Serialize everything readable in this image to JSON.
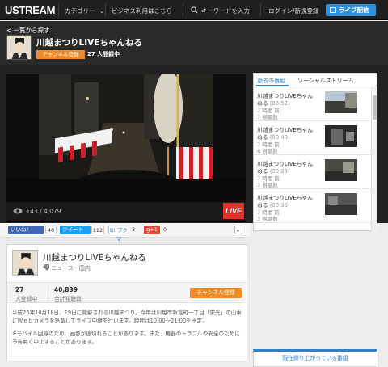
{
  "nav": {
    "logo": "USTREAM",
    "category": "カテゴリー",
    "chevron": "⌄",
    "business": "ビジネス利用はこちら",
    "search_placeholder": "キーワードを入力",
    "login": "ログイン/新規登録",
    "live_button": "ライブ配信"
  },
  "header": {
    "back_link": "< 一覧から探す",
    "channel_title": "川越まつりLIVEちゃんねる",
    "subscribe": "チャンネル登録",
    "subscribers": "27 人登録中"
  },
  "player": {
    "viewcount": "143 / 4,079",
    "live_badge": "LIVE"
  },
  "side": {
    "tabs": [
      "過去の番組",
      "ソーシャルストリーム"
    ],
    "items": [
      {
        "title": "川越まつりLIVEちゃん",
        "title2": "ねる",
        "duration": "(06:52)",
        "ago": "7 時間 前",
        "views": "7 視聴数"
      },
      {
        "title": "川越まつりLIVEちゃん",
        "title2": "ねる",
        "duration": "(00:40)",
        "ago": "7 時間 前",
        "views": "6 視聴数"
      },
      {
        "title": "川越まつりLIVEちゃん",
        "title2": "ねる",
        "duration": "(00:28)",
        "ago": "7 時間 前",
        "views": "3 視聴数"
      },
      {
        "title": "川越まつりLIVEちゃん",
        "title2": "ねる",
        "duration": "(00:30)",
        "ago": "7 時間 前",
        "views": "3 視聴数"
      }
    ],
    "related": "現在繰り上がっている番組"
  },
  "social": {
    "fb_label": "いいね！",
    "fb_count": "40",
    "tw_label": "ツイート",
    "tw_count": "112",
    "hatena_label": "B! ブクマ",
    "hatena_count": "3",
    "gplus_label": "g+1",
    "gplus_count": "0",
    "share": "▸"
  },
  "info": {
    "title": "川越まつりLIVEちゃんねる",
    "category": "ニュース - 国内",
    "stat1_num": "27",
    "stat1_lbl": "人登録中",
    "stat2_num": "40,839",
    "stat2_lbl": "合計視聴数",
    "subscribe": "チャンネル登録",
    "desc1": "平成26年10月18日、19日に開催される川越まつり。今年は川越市新富町一丁目「栄光」の山車にＷｅｂカメラを搭載してライブ中継を行います。時間は10:00～21:00を予定。",
    "desc2": "※モバイル回線のため、画像が途切れることがあります。また、機器のトラブルや安全のために予告無く中止することがあります。"
  },
  "colors": {
    "accent_blue": "#2f8fd8",
    "orange": "#f08a24",
    "live_red": "#e0302a"
  }
}
